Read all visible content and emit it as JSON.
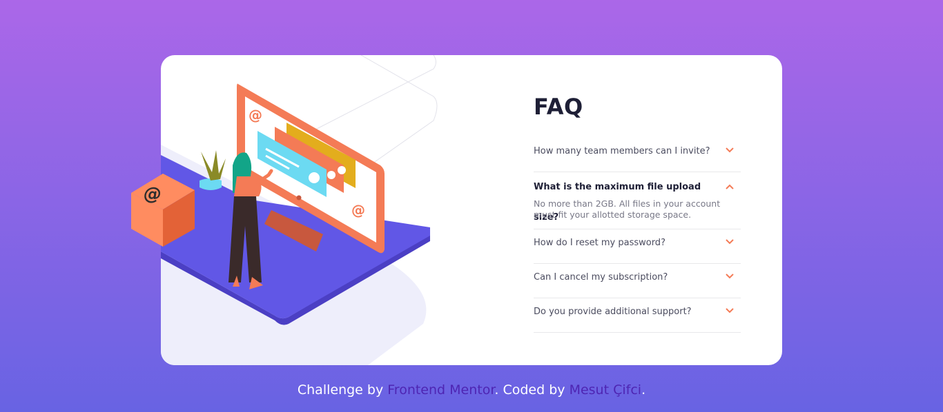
{
  "faq": {
    "title": "FAQ",
    "items": [
      {
        "question": "How many team members can I invite?",
        "icon": "chevron-down-icon"
      },
      {
        "question": "What is the maximum file upload size?",
        "answer": "No more than 2GB. All files in your account must fit your allotted storage space.",
        "icon": "chevron-up-icon"
      },
      {
        "question": "How do I reset my password?",
        "icon": "chevron-down-icon"
      },
      {
        "question": "Can I cancel my subscription?",
        "icon": "chevron-down-icon"
      },
      {
        "question": "Do you provide additional support?",
        "icon": "chevron-down-icon"
      }
    ]
  },
  "footer": {
    "prefix": "Challenge by ",
    "link1": "Frontend Mentor",
    "middle": ". Coded by ",
    "link2": "Mesut Çifci",
    "suffix": "."
  },
  "colors": {
    "accent": "#f47b56",
    "title": "#1e1f36",
    "link": "#4e25b3",
    "bg_top": "#ab67e8",
    "bg_bottom": "#6863e3"
  }
}
